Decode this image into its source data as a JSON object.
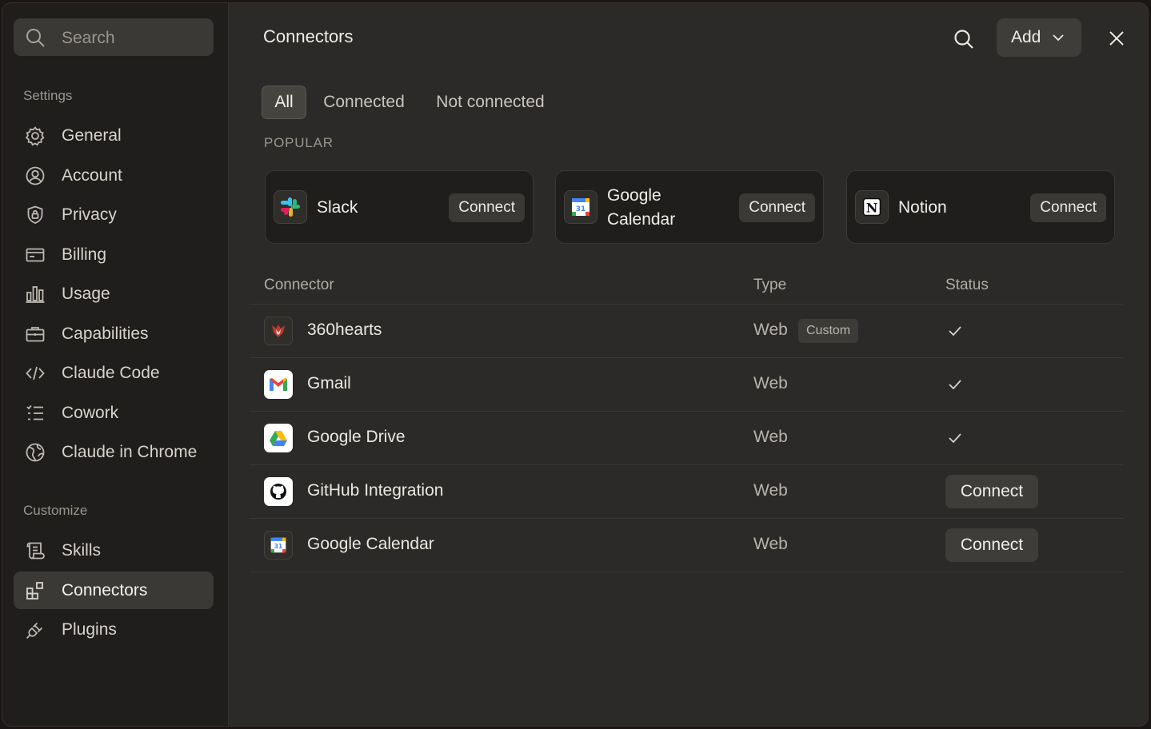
{
  "sidebar": {
    "search_placeholder": "Search",
    "sections": {
      "settings": "Settings",
      "customize": "Customize"
    },
    "items": [
      {
        "label": "General",
        "icon": "gear-icon"
      },
      {
        "label": "Account",
        "icon": "user-circle-icon"
      },
      {
        "label": "Privacy",
        "icon": "shield-icon"
      },
      {
        "label": "Billing",
        "icon": "credit-card-icon"
      },
      {
        "label": "Usage",
        "icon": "bar-chart-icon"
      },
      {
        "label": "Capabilities",
        "icon": "briefcase-icon"
      },
      {
        "label": "Claude Code",
        "icon": "code-icon"
      },
      {
        "label": "Cowork",
        "icon": "checklist-icon"
      },
      {
        "label": "Claude in Chrome",
        "icon": "globe-icon"
      },
      {
        "label": "Skills",
        "icon": "scroll-icon"
      },
      {
        "label": "Connectors",
        "icon": "grid-plus-icon",
        "active": true
      },
      {
        "label": "Plugins",
        "icon": "plug-icon"
      }
    ]
  },
  "header": {
    "title": "Connectors",
    "add_label": "Add"
  },
  "tabs": [
    {
      "label": "All",
      "active": true
    },
    {
      "label": "Connected"
    },
    {
      "label": "Not connected"
    }
  ],
  "popular": {
    "label": "POPULAR",
    "cards": [
      {
        "name": "Slack",
        "button": "Connect",
        "icon": "slack-icon"
      },
      {
        "name": "Google Calendar",
        "button": "Connect",
        "icon": "google-calendar-icon"
      },
      {
        "name": "Notion",
        "button": "Connect",
        "icon": "notion-icon"
      }
    ]
  },
  "table": {
    "headers": {
      "connector": "Connector",
      "type": "Type",
      "status": "Status"
    },
    "rows": [
      {
        "name": "360hearts",
        "type": "Web",
        "badge": "Custom",
        "status": "connected",
        "icon": "360hearts-logo-icon"
      },
      {
        "name": "Gmail",
        "type": "Web",
        "status": "connected",
        "icon": "gmail-icon"
      },
      {
        "name": "Google Drive",
        "type": "Web",
        "status": "connected",
        "icon": "google-drive-icon"
      },
      {
        "name": "GitHub Integration",
        "type": "Web",
        "status": "Connect",
        "icon": "github-icon"
      },
      {
        "name": "Google Calendar",
        "type": "Web",
        "status": "Connect",
        "icon": "google-calendar-icon"
      }
    ]
  },
  "colors": {
    "background": "#2b2a28",
    "sidebar": "#1f1e1c",
    "active_item": "#3a3936"
  }
}
